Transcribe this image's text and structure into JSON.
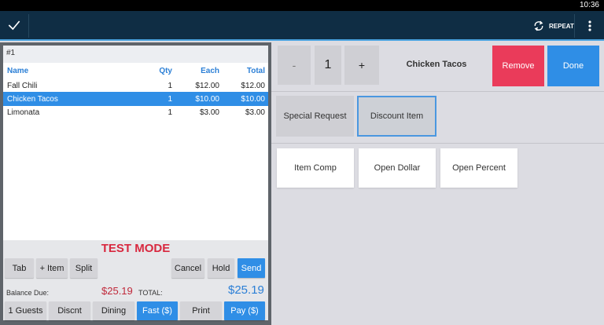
{
  "status_bar": {
    "time": "10:36"
  },
  "app_bar": {
    "repeat_label": "REPEAT"
  },
  "ticket": {
    "order_number": "#1",
    "columns": {
      "name": "Name",
      "qty": "Qty",
      "each": "Each",
      "total": "Total"
    },
    "items": [
      {
        "name": "Fall Chili",
        "qty": "1",
        "each": "$12.00",
        "total": "$12.00",
        "selected": false
      },
      {
        "name": "Chicken Tacos",
        "qty": "1",
        "each": "$10.00",
        "total": "$10.00",
        "selected": true
      },
      {
        "name": "Limonata",
        "qty": "1",
        "each": "$3.00",
        "total": "$3.00",
        "selected": false
      }
    ],
    "test_mode": "TEST MODE",
    "actions_row1": {
      "tab": "Tab",
      "add_item": "+ Item",
      "split": "Split",
      "cancel": "Cancel",
      "hold": "Hold",
      "send": "Send"
    },
    "balance_due_label": "Balance Due:",
    "balance_due_value": "$25.19",
    "total_label": "TOTAL:",
    "total_value": "$25.19",
    "actions_row2": {
      "guests": "1 Guests",
      "discount": "Discnt",
      "dining": "Dining",
      "fast": "Fast ($)",
      "print": "Print",
      "pay": "Pay ($)"
    }
  },
  "editor": {
    "minus": "-",
    "quantity": "1",
    "plus": "+",
    "item_name": "Chicken Tacos",
    "remove": "Remove",
    "done": "Done",
    "tabs": {
      "special_request": "Special Request",
      "discount_item": "Discount Item"
    },
    "options": {
      "item_comp": "Item Comp",
      "open_dollar": "Open Dollar",
      "open_percent": "Open Percent"
    }
  },
  "colors": {
    "app_bar": "#0f2d44",
    "accent_blue": "#2f8ee6",
    "remove_red": "#ea3b5a",
    "test_mode_red": "#d8283f"
  }
}
